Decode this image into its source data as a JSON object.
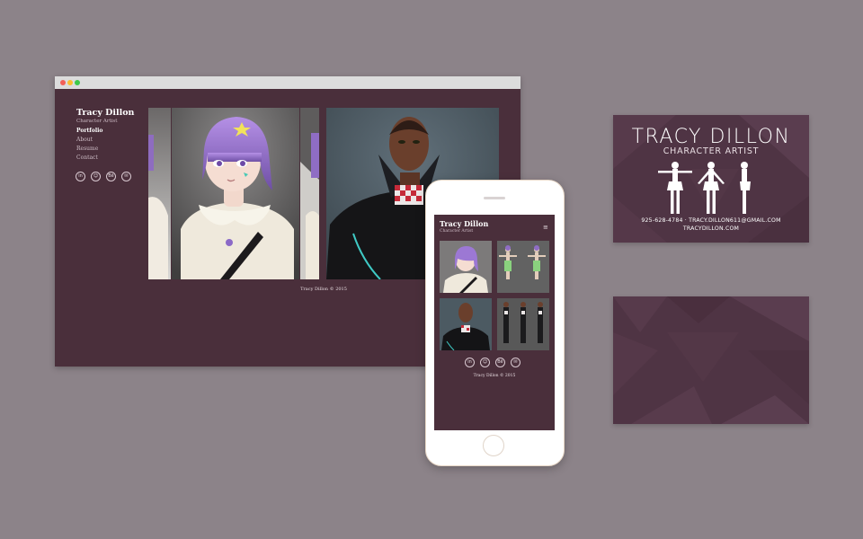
{
  "colors": {
    "backdrop": "#8c8389",
    "site_bg": "#4a2f3b",
    "card_bg": "#4f3444"
  },
  "desktop": {
    "window_controls": [
      "close",
      "minimize",
      "zoom"
    ],
    "site_name": "Tracy Dillon",
    "site_role": "Character Artist",
    "nav": [
      {
        "label": "Portfolio",
        "active": true
      },
      {
        "label": "About",
        "active": false
      },
      {
        "label": "Resume",
        "active": false
      },
      {
        "label": "Contact",
        "active": false
      }
    ],
    "social_icons": [
      "linkedin-icon",
      "smile-icon",
      "behance-icon",
      "email-icon"
    ],
    "gallery": [
      "purple-haired girl character render (partial)",
      "purple-haired girl character render",
      "purple-haired girl character render (partial)",
      "dark-skinned character with red scarf render"
    ],
    "copyright": "Tracy Dillon © 2015"
  },
  "mobile": {
    "site_name": "Tracy Dillon",
    "site_role": "Character Artist",
    "menu_icon": "hamburger-menu-icon",
    "tiles": [
      "purple-haired girl",
      "green-outfit character turnaround",
      "dark-skinned character with scarf",
      "dark outfit character turnaround"
    ],
    "social_icons": [
      "linkedin-icon",
      "smile-icon",
      "behance-icon",
      "email-icon"
    ],
    "copyright": "Tracy Dillon © 2015"
  },
  "card_front": {
    "title": "TRACY DILLON",
    "subtitle": "CHARACTER ARTIST",
    "contact_line": "925-628-4784 · TRACY.DILLON611@GMAIL.COM",
    "website": "TRACYDILLON.COM"
  },
  "card_back": {
    "pattern": "geometric-triangles"
  }
}
